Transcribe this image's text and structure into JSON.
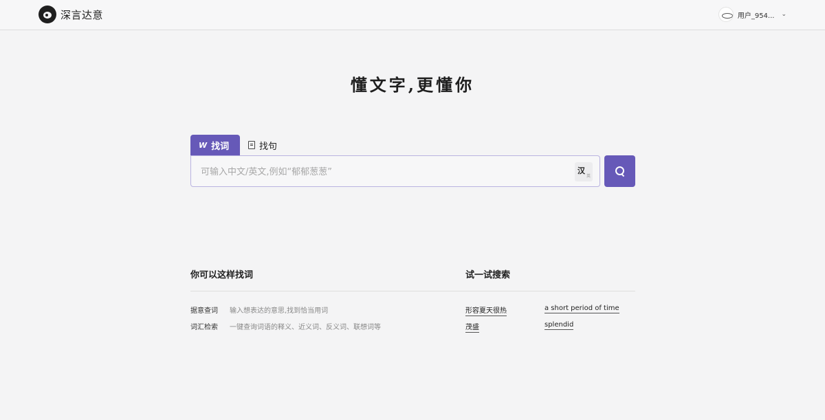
{
  "header": {
    "logo_text": "深言达意",
    "username": "用户_954...",
    "chevron": "⌄"
  },
  "slogan": "懂文字,更懂你",
  "tabs": [
    {
      "label": "找词",
      "icon": "w-icon",
      "active": true
    },
    {
      "label": "找句",
      "icon": "document-icon",
      "active": false
    }
  ],
  "search": {
    "placeholder": "可输入中文/英文,例如“郁郁葱葱”",
    "lang_main": "汉",
    "lang_sub": "英"
  },
  "tips": {
    "title": "你可以这样找词",
    "items": [
      {
        "label": "据意查词",
        "desc": "输入想表达的意思,找到恰当用词"
      },
      {
        "label": "词汇检索",
        "desc": "一键查询词语的释义、近义词、反义词、联想词等"
      }
    ]
  },
  "try": {
    "title": "试一试搜索",
    "items": [
      "形容夏天很热",
      "a short period of time",
      "茂盛",
      "splendid"
    ]
  },
  "colors": {
    "accent": "#6659b8",
    "background": "#f4f4f5"
  }
}
